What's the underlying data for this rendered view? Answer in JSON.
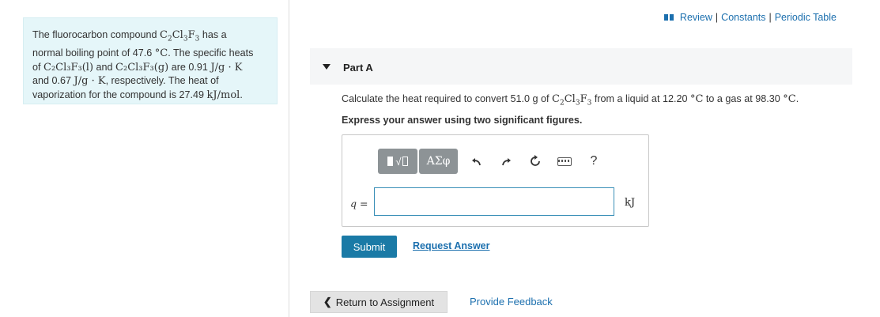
{
  "header": {
    "review_label": "Review",
    "constants_label": "Constants",
    "periodic_label": "Periodic Table",
    "separator": "|",
    "icon": "book-icon"
  },
  "problem": {
    "l1a": "The fluorocarbon compound ",
    "l1b": " has a",
    "l2": "normal boiling point of 47.6 ",
    "l2b": ". The specific heats",
    "l3a": "of ",
    "l3b": " and ",
    "l3c": " are 0.91 ",
    "l4a": "and 0.67 ",
    "l4b": ", respectively. The heat of",
    "l5a": "vaporization for the compound is 27.49 ",
    "l5b": ".",
    "degC": "°C",
    "formula_l": "C₂Cl₃F₃(l)",
    "formula_g": "C₂Cl₃F₃(g)",
    "units_jgk": "J/g · K",
    "units_kjmol": "kJ/mol"
  },
  "part": {
    "title": "Part A",
    "question_a": "Calculate the heat required to convert 51.0 g of ",
    "question_b": " from a liquid at 12.20 ",
    "question_c": " to a gas at 98.30 ",
    "question_d": ".",
    "instruction": "Express your answer using two significant figures."
  },
  "toolbar": {
    "templates": "template-icon",
    "greek": "ΑΣφ",
    "undo": "undo-icon",
    "redo": "redo-icon",
    "reset": "reset-icon",
    "keyboard": "keyboard-icon",
    "help": "?"
  },
  "answer": {
    "q_var": "q",
    "equals": " =",
    "value": "",
    "unit": "kJ"
  },
  "actions": {
    "submit": "Submit",
    "request": "Request Answer",
    "return": "Return to Assignment",
    "feedback": "Provide Feedback"
  },
  "colors": {
    "accent": "#1a7aa6",
    "link": "#1b6fae",
    "problem_bg": "#e5f6f9"
  }
}
